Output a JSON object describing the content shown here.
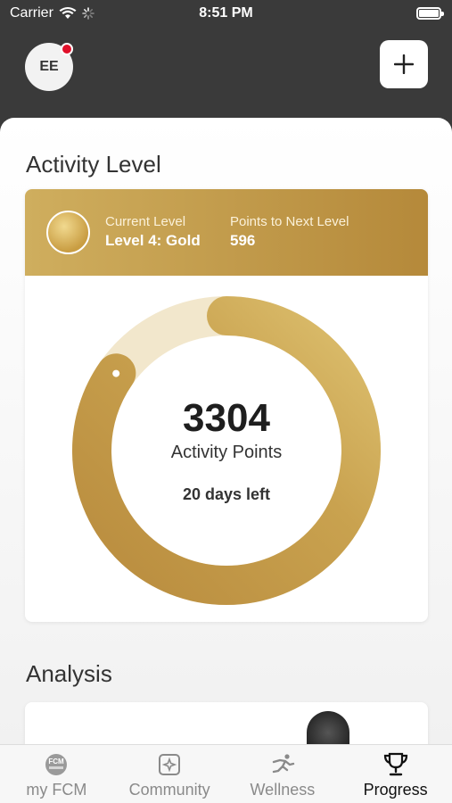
{
  "status_bar": {
    "carrier": "Carrier",
    "time": "8:51 PM"
  },
  "header": {
    "avatar_initials": "EE",
    "add_icon": "plus-icon"
  },
  "activity": {
    "section_title": "Activity Level",
    "current_level_label": "Current Level",
    "current_level_value": "Level 4: Gold",
    "next_level_label": "Points to Next Level",
    "next_level_value": "596",
    "points": "3304",
    "points_label": "Activity Points",
    "days_left": "20 days left",
    "progress_fraction": 0.847,
    "colors": {
      "gold_light": "#d9bc6a",
      "gold_dark": "#b5893a",
      "track": "#f2e7cc"
    }
  },
  "analysis": {
    "section_title": "Analysis"
  },
  "tabs": [
    {
      "label": "my FCM",
      "icon": "fcm-logo-icon",
      "active": false
    },
    {
      "label": "Community",
      "icon": "community-icon",
      "active": false
    },
    {
      "label": "Wellness",
      "icon": "runner-icon",
      "active": false
    },
    {
      "label": "Progress",
      "icon": "trophy-icon",
      "active": true
    }
  ]
}
